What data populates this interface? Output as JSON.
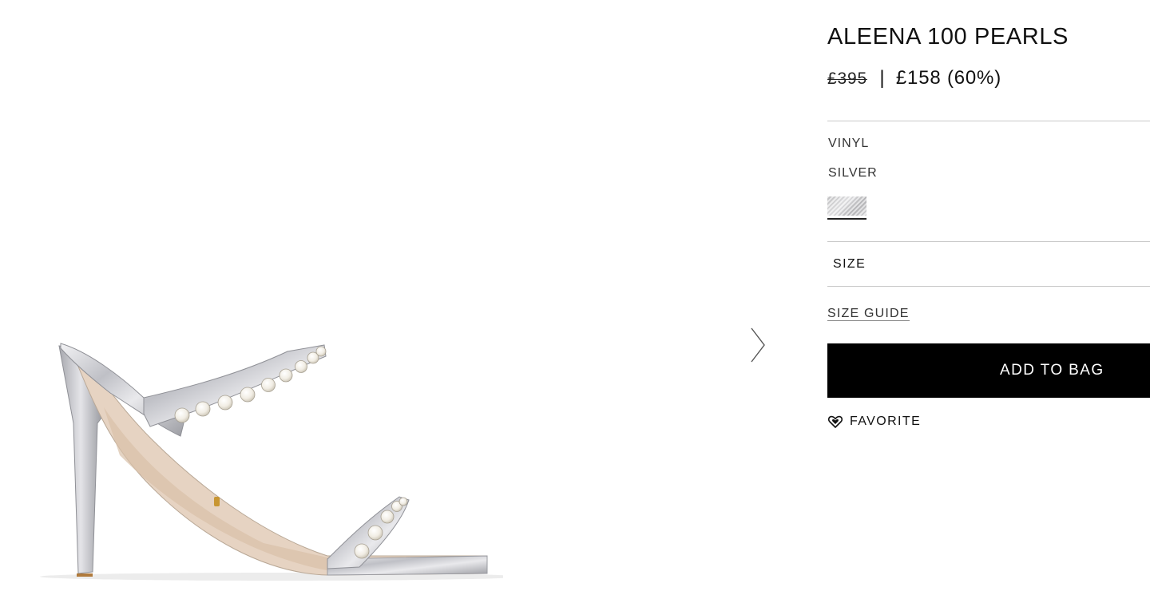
{
  "product": {
    "name": "ALEENA 100 PEARLS",
    "price_original": "£395",
    "price_separator": "|",
    "price_sale": "£158 (60%)",
    "material": "VINYL",
    "color": "SILVER",
    "swatch_color": "#d2d2d4"
  },
  "size": {
    "label": "SIZE",
    "guide_label": "SIZE GUIDE"
  },
  "actions": {
    "add_to_bag": "ADD TO BAG",
    "favorite": "FAVORITE"
  },
  "gallery": {
    "next_icon": "chevron-right-icon"
  },
  "colors": {
    "button_bg": "#000000",
    "button_text": "#ffffff",
    "divider": "#c9c9c9"
  }
}
